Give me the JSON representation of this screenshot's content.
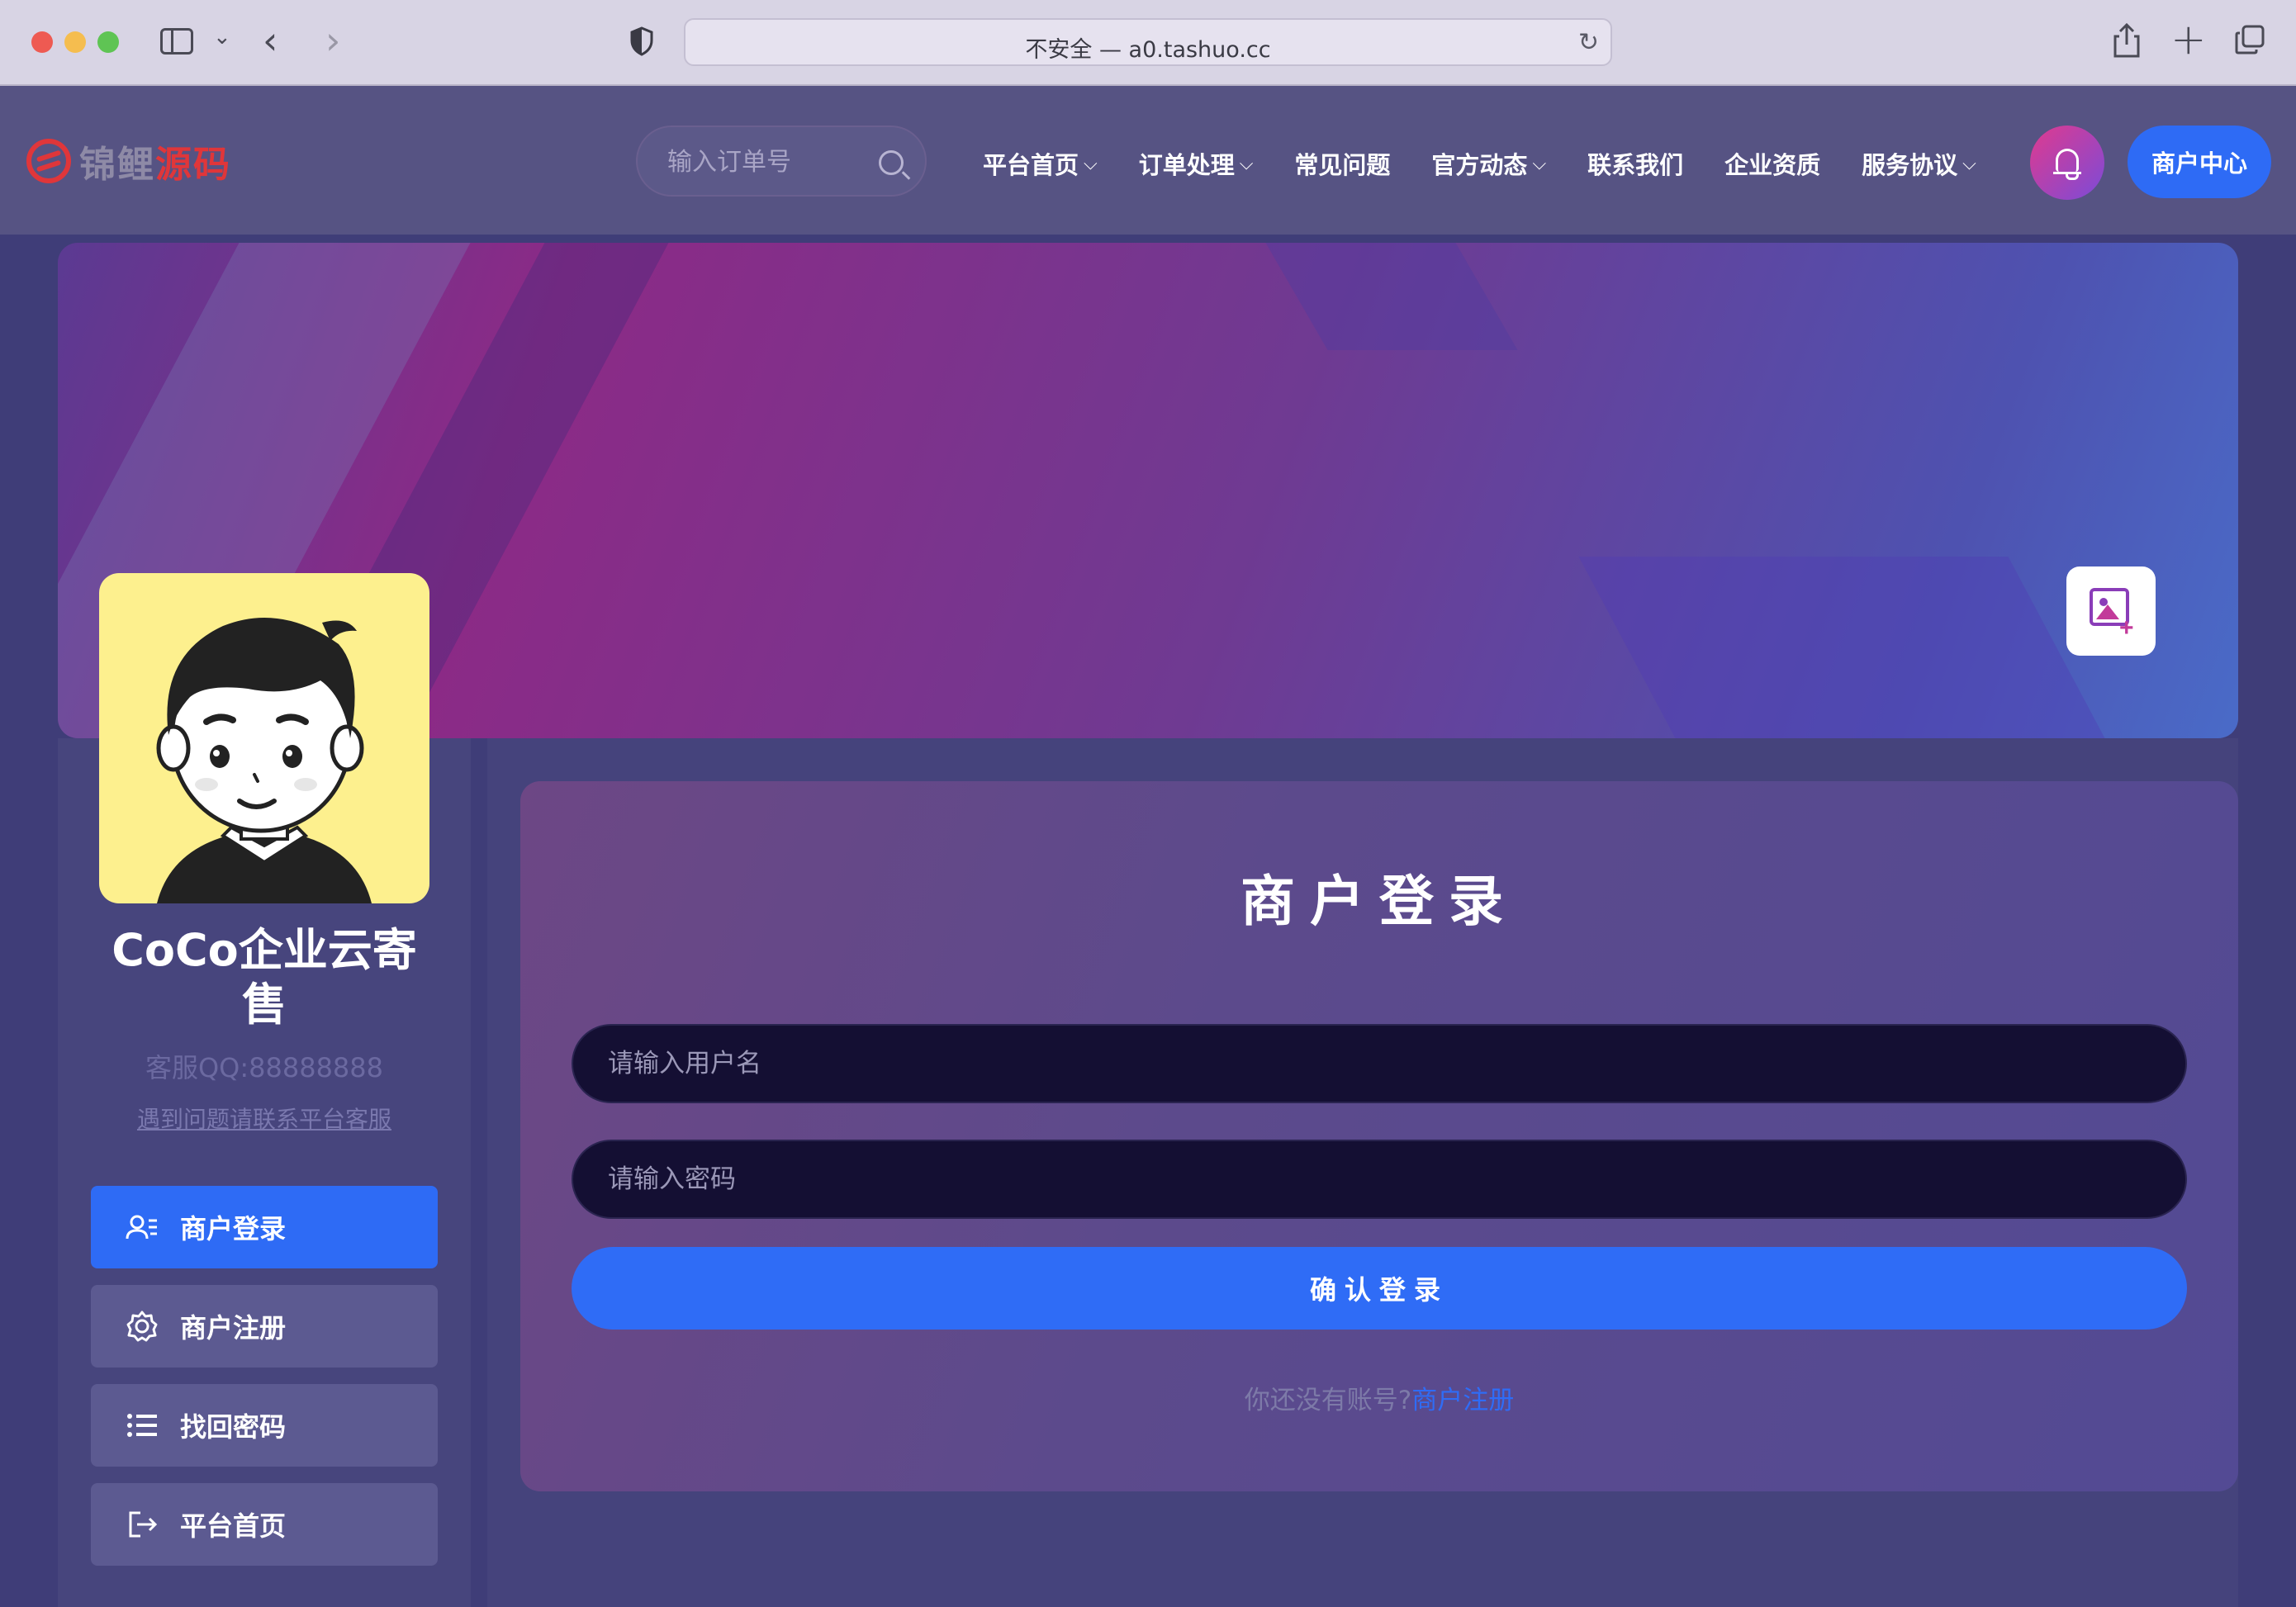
{
  "browser": {
    "address": "不安全 — a0.tashuo.cc"
  },
  "header": {
    "logo_part1": "锦鲤",
    "logo_part2": "源码",
    "search_placeholder": "输入订单号",
    "nav": [
      {
        "label": "平台首页",
        "has_dropdown": true
      },
      {
        "label": "订单处理",
        "has_dropdown": true
      },
      {
        "label": "常见问题",
        "has_dropdown": false
      },
      {
        "label": "官方动态",
        "has_dropdown": true
      },
      {
        "label": "联系我们",
        "has_dropdown": false
      },
      {
        "label": "企业资质",
        "has_dropdown": false
      },
      {
        "label": "服务协议",
        "has_dropdown": true
      }
    ],
    "merchant_center": "商户中心"
  },
  "profile": {
    "shop_name_line1": "CoCo企业云寄",
    "shop_name_line2": "售",
    "qq": "客服QQ:88888888",
    "help": "遇到问题请联系平台客服",
    "menu": [
      {
        "label": "商户登录",
        "icon": "user-list-icon",
        "active": true
      },
      {
        "label": "商户注册",
        "icon": "gear-icon",
        "active": false
      },
      {
        "label": "找回密码",
        "icon": "list-icon",
        "active": false
      },
      {
        "label": "平台首页",
        "icon": "logout-icon",
        "active": false
      }
    ]
  },
  "login": {
    "title": "商户登录",
    "username_placeholder": "请输入用户名",
    "password_placeholder": "请输入密码",
    "submit": "确认登录",
    "no_account": "你还没有账号?",
    "register_link": "商户注册"
  },
  "colors": {
    "accent": "#2e6bf5",
    "brand_red": "#e0363a",
    "avatar_bg": "#fdf08e"
  }
}
